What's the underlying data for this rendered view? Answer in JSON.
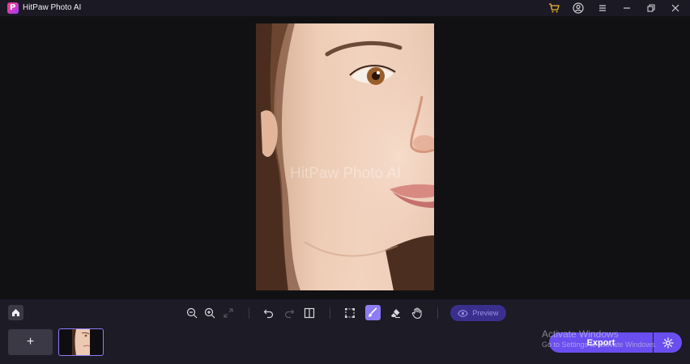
{
  "app": {
    "title": "HitPaw Photo AI",
    "logo_letter": "P"
  },
  "titlebar_icons": [
    "cart-icon",
    "account-icon",
    "menu-icon",
    "minimize-icon",
    "restore-icon",
    "close-icon"
  ],
  "canvas": {
    "watermark": "HitPaw Photo AI"
  },
  "toolbar": {
    "tools": [
      "zoom-out-icon",
      "zoom-in-icon",
      "fit-screen-icon",
      "undo-icon",
      "redo-icon",
      "compare-icon",
      "select-icon",
      "brush-icon",
      "eraser-icon",
      "hand-icon"
    ],
    "active_tool": "brush-icon",
    "preview_label": "Preview"
  },
  "bottom": {
    "add_label": "+",
    "export_label": "Export"
  },
  "watermark_os": {
    "line1": "Activate Windows",
    "line2": "Go to Settings to activate Windows."
  },
  "colors": {
    "accent": "#6b4ef0",
    "active_tool": "#8d7cf6",
    "cart": "#f5b82e"
  }
}
